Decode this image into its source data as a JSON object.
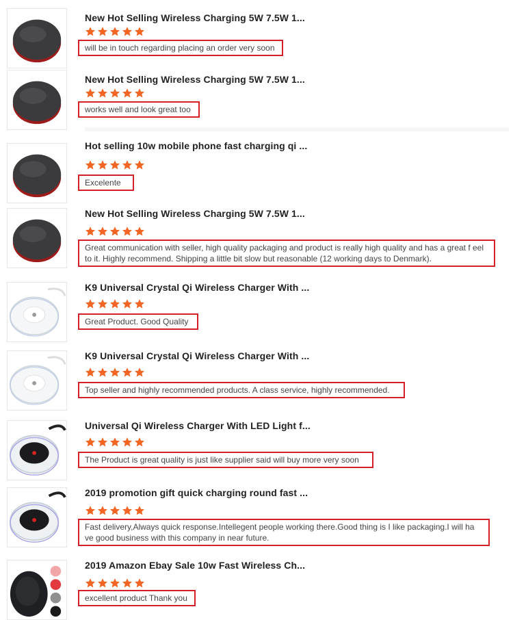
{
  "colors": {
    "star": "#f26522",
    "highlight": "#d41f28",
    "divider": "#f5f5f5"
  },
  "reviews": [
    {
      "title": "New Hot Selling Wireless Charging 5W 7.5W 1...",
      "rating": 5,
      "comment": "will be in touch regarding placing an order very soon",
      "thumb": "black-red-charger-pad"
    },
    {
      "title": "New Hot Selling Wireless Charging 5W 7.5W 1...",
      "rating": 5,
      "comment": "works well and look great too",
      "thumb": "black-red-charger-pad"
    },
    {
      "title": "Hot selling 10w mobile phone fast charging qi ...",
      "rating": 5,
      "comment": "Excelente",
      "thumb": "black-red-charger-pad"
    },
    {
      "title": "New Hot Selling Wireless Charging 5W 7.5W 1...",
      "rating": 5,
      "comment": "Great communication with seller, high quality packaging and product is really high quality and has a great f eel to it. Highly recommend. Shipping a little bit slow but reasonable (12 working days to Denmark).",
      "thumb": "black-red-charger-pad"
    },
    {
      "title": "K9 Universal Crystal Qi Wireless Charger With ...",
      "rating": 5,
      "comment": "Great Product. Good Quality",
      "thumb": "crystal-white-charger"
    },
    {
      "title": "K9 Universal Crystal Qi Wireless Charger With ...",
      "rating": 5,
      "comment": "Top seller and highly recommended products. A class service, highly recommended.",
      "thumb": "crystal-white-charger"
    },
    {
      "title": "Universal Qi Wireless Charger With LED Light f...",
      "rating": 5,
      "comment": "The Product is great quality is just like supplier said will buy more very soon",
      "thumb": "crystal-black-charger"
    },
    {
      "title": "2019 promotion gift quick charging round fast ...",
      "rating": 5,
      "comment": "Fast delivery,Always quick response.Intellegent people working there.Good thing is I like packaging.I will ha ve good business with this company in near future.",
      "thumb": "crystal-black-charger"
    },
    {
      "title": "2019 Amazon Ebay Sale 10w Fast Wireless Ch...",
      "rating": 5,
      "comment": "excellent product Thank you",
      "thumb": "color-variants-charger"
    }
  ]
}
